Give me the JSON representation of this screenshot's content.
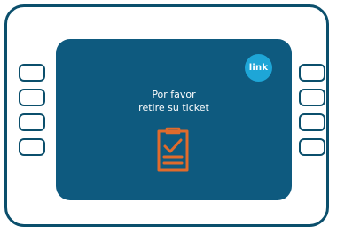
{
  "screen": {
    "message_line1": "Por favor",
    "message_line2": "retire su ticket",
    "brand_badge": "link",
    "icon": "ticket-checklist-icon"
  },
  "side_keys": {
    "left_count": 4,
    "right_count": 4
  },
  "colors": {
    "frame": "#0b4f6c",
    "screen": "#0e5a7f",
    "badge": "#1ea6d7",
    "icon": "#e06b2c",
    "text": "#ffffff"
  }
}
